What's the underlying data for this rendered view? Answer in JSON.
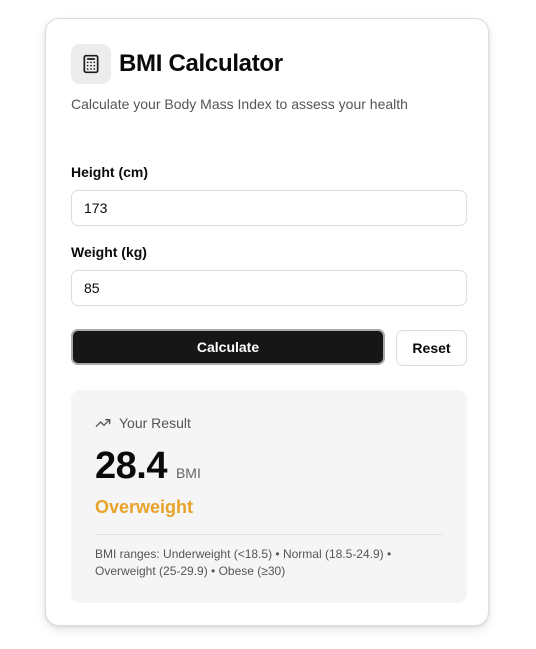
{
  "header": {
    "title": "BMI Calculator",
    "subtitle": "Calculate your Body Mass Index to assess your health",
    "icon": "calculator-icon"
  },
  "form": {
    "height_label": "Height (cm)",
    "height_value": "173",
    "weight_label": "Weight (kg)",
    "weight_value": "85",
    "calculate_label": "Calculate",
    "reset_label": "Reset"
  },
  "result": {
    "heading": "Your Result",
    "heading_icon": "trending-up-icon",
    "bmi_value": "28.4",
    "bmi_unit": "BMI",
    "category": "Overweight",
    "category_color": "#e8a32a",
    "ranges_text": "BMI ranges: Underweight (<18.5) • Normal (18.5-24.9) • Overweight (25-29.9) • Obese (≥30)"
  }
}
